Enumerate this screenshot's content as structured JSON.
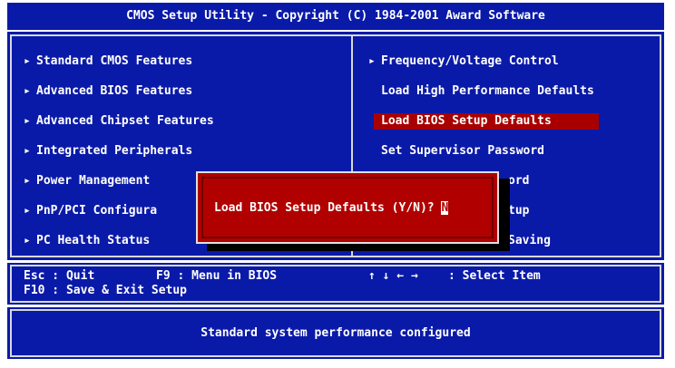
{
  "title": "CMOS Setup Utility - Copyright (C) 1984-2001 Award Software",
  "left_menu": [
    {
      "label": "Standard CMOS Features",
      "arrow": "▸"
    },
    {
      "label": "Advanced BIOS Features",
      "arrow": "▸"
    },
    {
      "label": "Advanced Chipset Features",
      "arrow": "▸"
    },
    {
      "label": "Integrated Peripherals",
      "arrow": "▸"
    },
    {
      "label": "Power Management",
      "arrow": "▸"
    },
    {
      "label": "PnP/PCI Configura",
      "arrow": "▸"
    },
    {
      "label": "PC Health Status",
      "arrow": "▸"
    }
  ],
  "right_menu": [
    {
      "label": "Frequency/Voltage Control",
      "arrow": "▸"
    },
    {
      "label": "Load High Performance Defaults",
      "arrow": ""
    },
    {
      "label": "Load BIOS Setup Defaults",
      "arrow": "",
      "selected": true
    },
    {
      "label": "Set Supervisor Password",
      "arrow": ""
    },
    {
      "label": "ord",
      "arrow": ""
    },
    {
      "label": "tup",
      "arrow": ""
    },
    {
      "label": "Saving",
      "arrow": ""
    }
  ],
  "help": {
    "line1_left": "Esc : Quit",
    "line1_mid": "F9 : Menu in BIOS",
    "line1_keys": "↑ ↓ ← →",
    "line1_right": ": Select Item",
    "line2_left": "F10 : Save & Exit Setup"
  },
  "status": "Standard system performance configured",
  "dialog": {
    "prompt": "Load BIOS Setup Defaults (Y/N)? ",
    "input": "N"
  },
  "colors": {
    "bios_blue": "#0a1aa8",
    "highlight_red": "#a80000",
    "dialog_red": "#b00000",
    "frame": "#d8d8d8"
  }
}
